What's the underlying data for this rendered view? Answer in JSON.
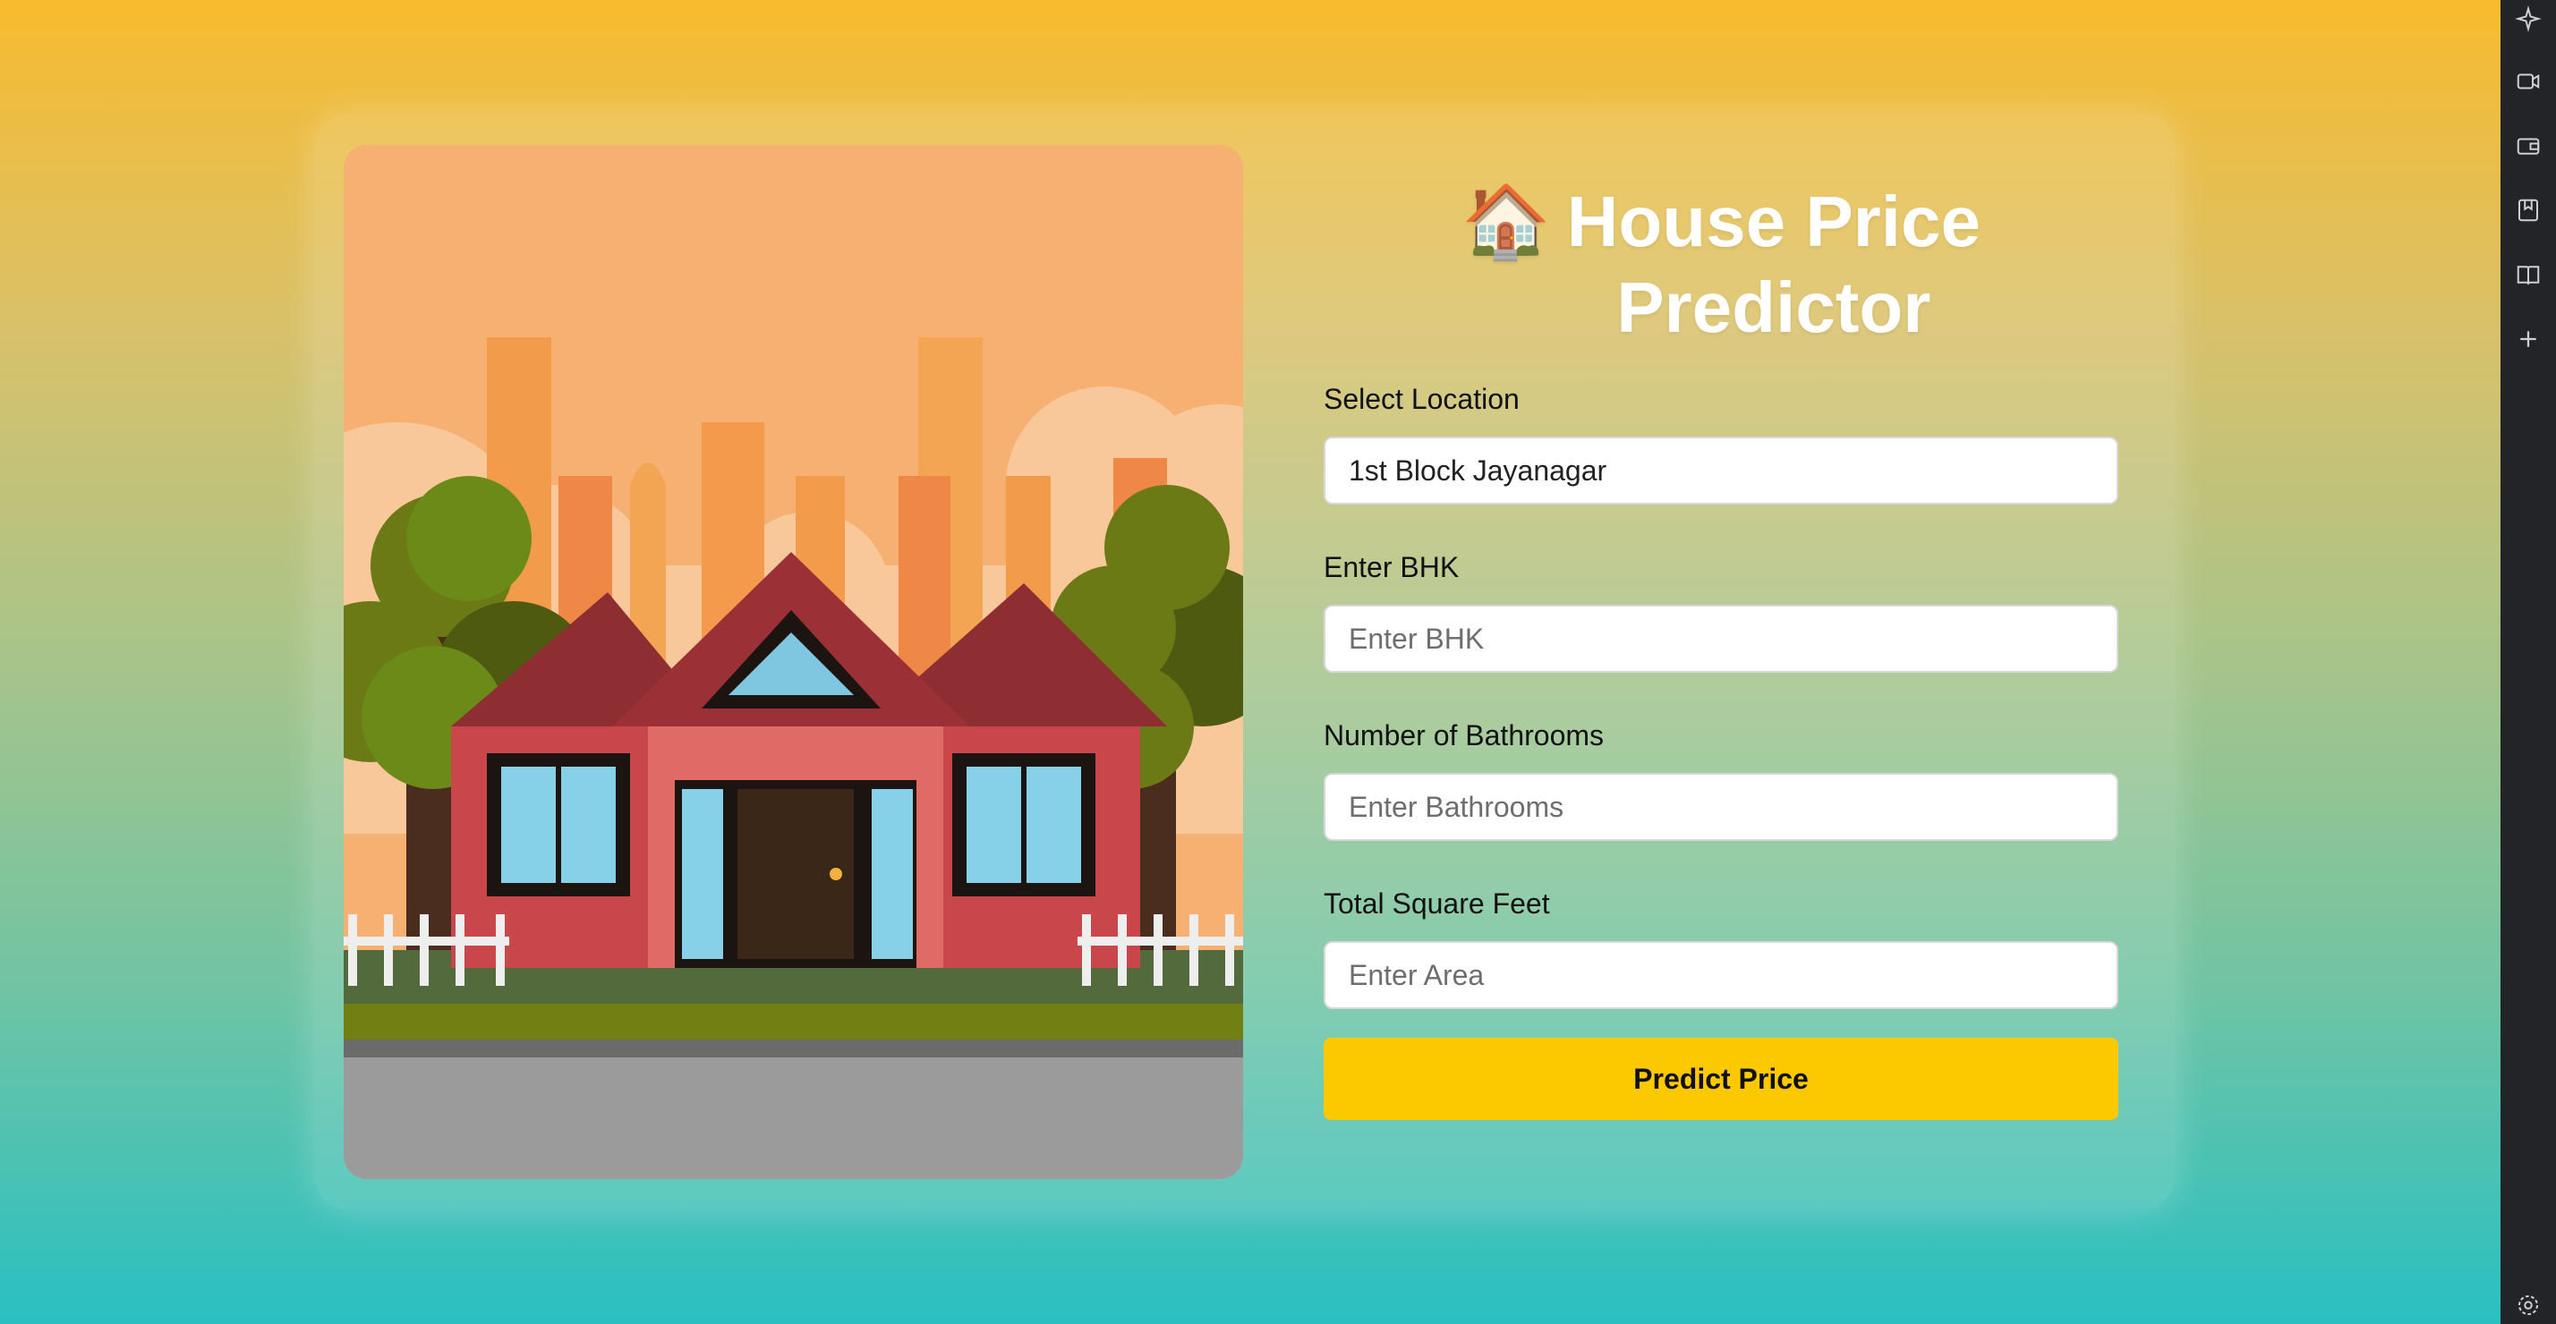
{
  "app": {
    "title_icon": "house-emoji",
    "title_glyph": "🏠",
    "title_line1": "House Price",
    "title_line2": "Predictor"
  },
  "form": {
    "location": {
      "label": "Select Location",
      "value": "1st Block Jayanagar"
    },
    "bhk": {
      "label": "Enter BHK",
      "placeholder": "Enter BHK"
    },
    "bathrooms": {
      "label": "Number of Bathrooms",
      "placeholder": "Enter Bathrooms"
    },
    "sqft": {
      "label": "Total Square Feet",
      "placeholder": "Enter Area"
    },
    "submit_label": "Predict Price"
  },
  "sidebar": {
    "icons": [
      "sparkle-icon",
      "video-icon",
      "wallet-icon",
      "bookmark-icon",
      "reader-icon",
      "add-icon",
      "settings-icon"
    ]
  },
  "colors": {
    "accent_button": "#fcc800",
    "sidebar_bg": "#232428",
    "gradient_top": "#f8bb2e",
    "gradient_bottom": "#29c0c2"
  }
}
